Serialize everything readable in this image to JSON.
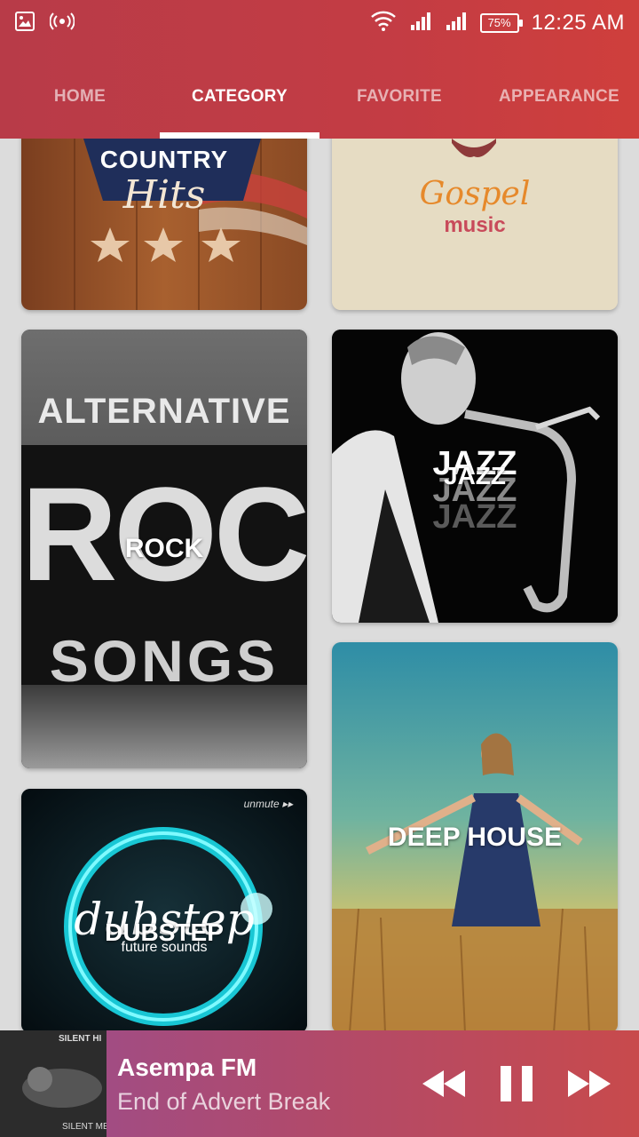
{
  "status_bar": {
    "battery": "75%",
    "time": "12:25 AM"
  },
  "tabs": [
    {
      "label": "HOME"
    },
    {
      "label": "CATEGORY"
    },
    {
      "label": "FAVORITE"
    },
    {
      "label": "APPEARANCE"
    }
  ],
  "categories": {
    "country": {
      "art_line1": "COUNTRY",
      "art_line2": "Hits"
    },
    "gospel": {
      "art_line1": "Gospel",
      "art_line2": "music"
    },
    "rock": {
      "title": "ROCK",
      "art_line1": "ALTERNATIVE",
      "art_line2": "ROCK",
      "art_line3": "SONGS"
    },
    "jazz": {
      "title": "JAZZ",
      "art_line1": "JAZZ",
      "art_line2": "JAZZ",
      "art_line3": "JAZZ"
    },
    "dubstep": {
      "title": "DUBSTEP",
      "art_line1": "dubstep",
      "art_line2": "future sounds",
      "art_brand": "unmute ▸▸"
    },
    "deep_house": {
      "title": "DEEP HOUSE"
    }
  },
  "player": {
    "thumb_text": "SILENT HI",
    "thumb_text2": "SILENT MEN",
    "station": "Asempa FM",
    "now_playing": "End of Advert Break"
  },
  "colors": {
    "header": "#c33c44",
    "accent": "#ffffff"
  }
}
